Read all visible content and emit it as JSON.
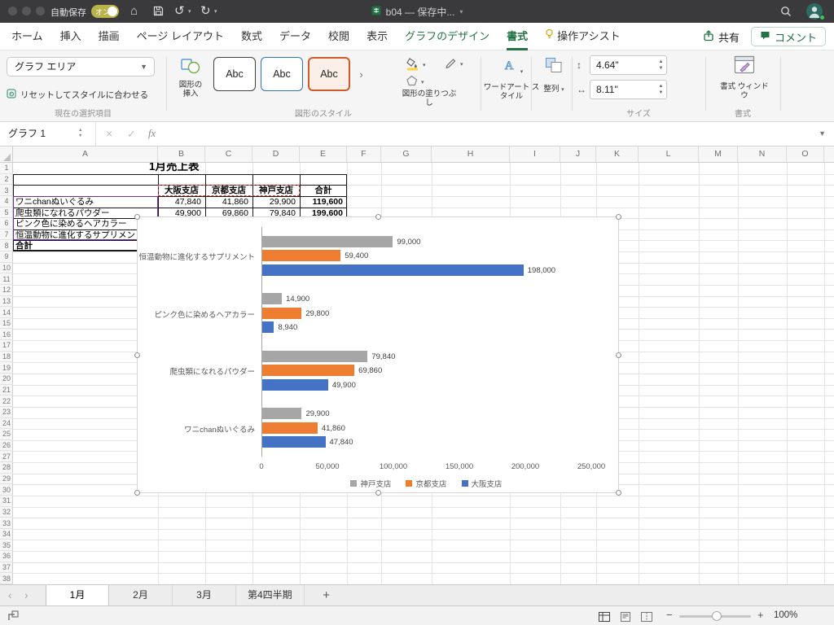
{
  "titlebar": {
    "autosave_label": "自動保存",
    "autosave_state": "オン",
    "doc_title": "b04 — 保存中..."
  },
  "tabs": {
    "items": [
      {
        "label": "ホーム"
      },
      {
        "label": "挿入"
      },
      {
        "label": "描画"
      },
      {
        "label": "ページ レイアウト"
      },
      {
        "label": "数式"
      },
      {
        "label": "データ"
      },
      {
        "label": "校閲"
      },
      {
        "label": "表示"
      },
      {
        "label": "グラフのデザイン",
        "contextual": true
      },
      {
        "label": "書式",
        "contextual": true,
        "active": true
      },
      {
        "label": "操作アシスト",
        "icon": "lightbulb"
      }
    ],
    "share_label": "共有",
    "comment_label": "コメント"
  },
  "ribbon": {
    "selection_value": "グラフ エリア",
    "reset_label": "リセットしてスタイルに合わせる",
    "group_selection": "現在の選択項目",
    "insert_shapes_label": "図形の挿入",
    "style_sample": "Abc",
    "shape_fill_label": "図形の塗りつぶし",
    "group_shape_styles": "図形のスタイル",
    "wordart_label": "ワードアート スタイル",
    "arrange_label": "整列",
    "height_value": "4.64\"",
    "width_value": "8.11\"",
    "group_size": "サイズ",
    "format_pane_label": "書式 ウィンドウ",
    "group_format": "書式"
  },
  "formula_bar": {
    "name_box": "グラフ 1",
    "fx_label": "fx"
  },
  "grid": {
    "columns": [
      "A",
      "B",
      "C",
      "D",
      "E",
      "F",
      "G",
      "H",
      "I",
      "J",
      "K",
      "L",
      "M",
      "N",
      "O"
    ],
    "row_count": 38
  },
  "sheet": {
    "title": "1月売上表",
    "header_row": [
      "大阪支店",
      "京都支店",
      "神戸支店",
      "合計"
    ],
    "data_rows": [
      {
        "label": "ワニchanぬいぐるみ",
        "values": [
          "47,840",
          "41,860",
          "29,900",
          "119,600"
        ]
      },
      {
        "label": "爬虫類になれるパウダー",
        "values": [
          "49,900",
          "69,860",
          "79,840",
          "199,600"
        ]
      },
      {
        "label": "ピンク色に染めるヘアカラー",
        "values": [
          "",
          "",
          "",
          ""
        ]
      },
      {
        "label": "恒温動物に進化するサプリメント",
        "values": [
          "",
          "",
          "",
          ""
        ]
      },
      {
        "label": "合計",
        "values": [
          "",
          "",
          "",
          ""
        ]
      }
    ]
  },
  "chart_data": {
    "type": "bar",
    "orientation": "horizontal",
    "categories": [
      "恒温動物に進化するサプリメント",
      "ピンク色に染めるヘアカラー",
      "爬虫類になれるパウダー",
      "ワニchanぬいぐるみ"
    ],
    "series": [
      {
        "name": "神戸支店",
        "color": "#a6a6a6",
        "values": [
          99000,
          14900,
          79840,
          29900
        ],
        "labels": [
          "99,000",
          "14,900",
          "79,840",
          "29,900"
        ]
      },
      {
        "name": "京都支店",
        "color": "#ed7d31",
        "values": [
          59400,
          29800,
          69860,
          41860
        ],
        "labels": [
          "59,400",
          "29,800",
          "69,860",
          "41,860"
        ]
      },
      {
        "name": "大阪支店",
        "color": "#4472c4",
        "values": [
          198000,
          8940,
          49900,
          47840
        ],
        "labels": [
          "198,000",
          "8,940",
          "49,900",
          "47,840"
        ]
      }
    ],
    "xlim": [
      0,
      250000
    ],
    "x_ticks": [
      "0",
      "50,000",
      "100,000",
      "150,000",
      "200,000",
      "250,000"
    ],
    "legend_position": "bottom",
    "gridlines": false
  },
  "sheet_tabs": {
    "items": [
      {
        "label": "1月",
        "active": true
      },
      {
        "label": "2月"
      },
      {
        "label": "3月"
      },
      {
        "label": "第4四半期"
      }
    ],
    "add_label": "+"
  },
  "status_bar": {
    "zoom_label": "100%"
  }
}
